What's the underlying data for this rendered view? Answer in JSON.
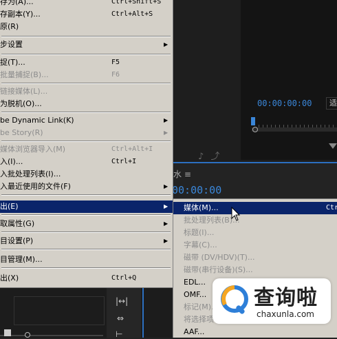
{
  "main_menu": {
    "items": [
      {
        "label": "存为(A)...",
        "shortcut": "Ctrl+Shift+S",
        "top": 0
      },
      {
        "label": "存副本(Y)...",
        "shortcut": "Ctrl+Alt+S"
      },
      {
        "label": "原(R)"
      },
      {
        "label": "步设置"
      },
      {
        "label": "捉(T)...",
        "shortcut": "F5"
      },
      {
        "label": "批量捕捉(B)...",
        "shortcut": "F6"
      },
      {
        "label": "链接媒体(L)..."
      },
      {
        "label": "为脱机(O)..."
      },
      {
        "label": "be Dynamic Link(K)"
      },
      {
        "label": "be Story(R)"
      },
      {
        "label": "媒体浏览器导入(M)",
        "shortcut": "Ctrl+Alt+I"
      },
      {
        "label": "入(I)...",
        "shortcut": "Ctrl+I"
      },
      {
        "label": "入批处理列表(I)..."
      },
      {
        "label": "入最近使用的文件(F)"
      },
      {
        "label": "出(E)"
      },
      {
        "label": "取属性(G)"
      },
      {
        "label": "目设置(P)"
      },
      {
        "label": "目管理(M)..."
      },
      {
        "label": "出(X)",
        "shortcut": "Ctrl+Q"
      }
    ]
  },
  "export_submenu": {
    "items": [
      {
        "label": "媒体(M)...",
        "shortcut": "Ctr"
      },
      {
        "label": "批处理列表(B)..."
      },
      {
        "label": "标题(I)..."
      },
      {
        "label": "字幕(C)..."
      },
      {
        "label": "磁带 (DV/HDV)(T)..."
      },
      {
        "label": "磁带(串行设备)(S)..."
      },
      {
        "label": "EDL..."
      },
      {
        "label": "OMF..."
      },
      {
        "label": "标记(M)..."
      },
      {
        "label": "将选择项..."
      },
      {
        "label": "AAF..."
      }
    ]
  },
  "monitor": {
    "timecode": "00:00:00:00",
    "fit_label": "适"
  },
  "timeline": {
    "tab_label": "≡",
    "tab_prefix": "水",
    "timecode": "00:00:00"
  },
  "watermark": {
    "title": "查询啦",
    "domain": "chaxunla.com"
  },
  "colors": {
    "menu_bg": "#d4d0c8",
    "highlight": "#0a246a",
    "disabled_text": "#8c8c8c",
    "accent_blue": "#3a86d8",
    "watermark_logo_orange": "#f5a623",
    "watermark_logo_blue": "#2e7fd8"
  }
}
